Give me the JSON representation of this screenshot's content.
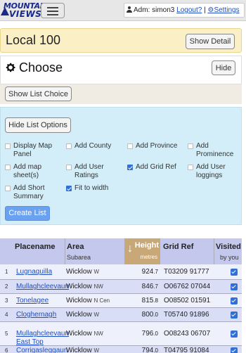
{
  "header": {
    "logo_top": "MOUNTAIN",
    "logo_bottom": "VIEWS",
    "user_label": "Adm: simon3",
    "logout_label": "Logout?",
    "separator": "|",
    "settings_label": "Settings"
  },
  "local": {
    "title": "Local 100",
    "show_detail_label": "Show Detail"
  },
  "choose": {
    "title": "Choose",
    "hide_label": "Hide",
    "show_list_choice_label": "Show List Choice"
  },
  "options": {
    "hide_list_options_label": "Hide List Options",
    "items": [
      {
        "label": "Display Map Panel",
        "checked": false
      },
      {
        "label": "Add County",
        "checked": false
      },
      {
        "label": "Add Province",
        "checked": false
      },
      {
        "label": "Add Prominence",
        "checked": false
      },
      {
        "label": "Add map sheet(s)",
        "checked": false
      },
      {
        "label": "Add User Ratings",
        "checked": false
      },
      {
        "label": "Add Grid Ref",
        "checked": true
      },
      {
        "label": "Add User loggings",
        "checked": false
      },
      {
        "label": "Add Short Summary",
        "checked": false
      },
      {
        "label": "Fit to width",
        "checked": true
      }
    ],
    "create_list_label": "Create List"
  },
  "table": {
    "headers": {
      "placename": "Placename",
      "area": "Area",
      "subarea": "Subarea",
      "height": "Height",
      "height_unit": "metres",
      "height_sort_icon": "down-arrow",
      "gridref": "Grid Ref",
      "visited": "Visited",
      "visited_sub": "by you"
    },
    "rows": [
      {
        "num": "1",
        "name": "Lugnaquilla",
        "area": "Wicklow",
        "sub": "W",
        "height": "924",
        "dec": ".7",
        "grid1": "T03209",
        "grid2": "91777",
        "visited": true
      },
      {
        "num": "2",
        "name": "Mullaghcleevaun",
        "area": "Wicklow",
        "sub": "NW",
        "height": "846",
        "dec": ".7",
        "grid1": "O06762",
        "grid2": "07044",
        "visited": true
      },
      {
        "num": "3",
        "name": "Tonelagee",
        "area": "Wicklow",
        "sub": "N Cen",
        "height": "815",
        "dec": ".8",
        "grid1": "O08502",
        "grid2": "01591",
        "visited": true
      },
      {
        "num": "4",
        "name": "Cloghernagh",
        "area": "Wicklow",
        "sub": "W",
        "height": "800",
        "dec": ".0",
        "grid1": "T05740",
        "grid2": "91896",
        "visited": true
      },
      {
        "num": "5",
        "name": "Mullaghcleevaun East Top",
        "area": "Wicklow",
        "sub": "NW",
        "height": "796",
        "dec": ".0",
        "grid1": "O08243",
        "grid2": "06707",
        "visited": true
      },
      {
        "num": "6",
        "name": "Corrigasleggaun",
        "area": "Wicklow",
        "sub": "W",
        "height": "794",
        "dec": ".0",
        "grid1": "T04795",
        "grid2": "91084",
        "visited": true
      }
    ]
  }
}
